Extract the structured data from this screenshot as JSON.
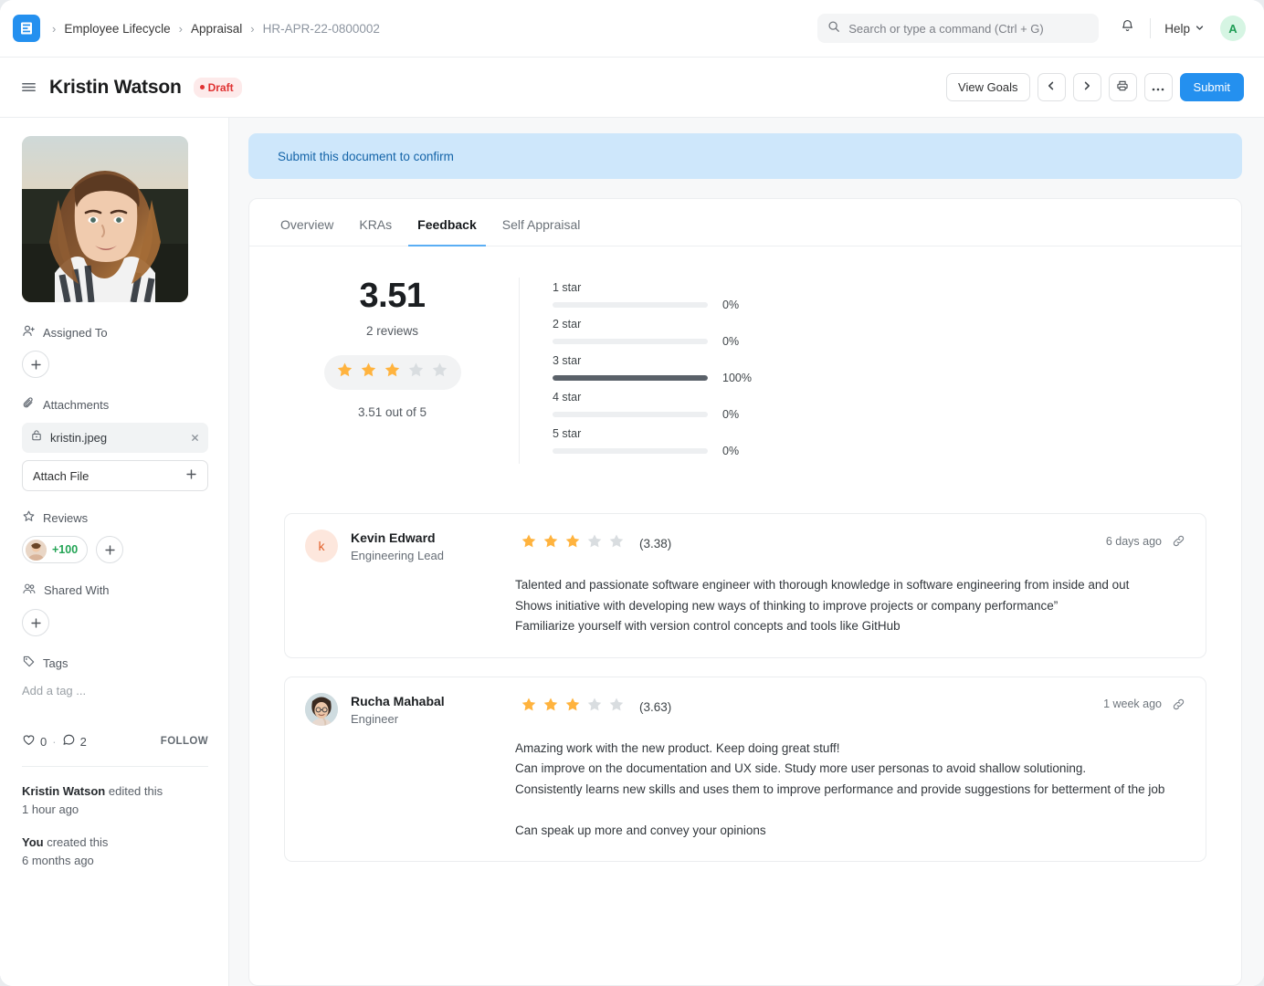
{
  "navbar": {
    "logo_icon": "frappe-logo-icon",
    "breadcrumb": [
      {
        "label": "Employee Lifecycle",
        "current": false
      },
      {
        "label": "Appraisal",
        "current": false
      },
      {
        "label": "HR-APR-22-0800002",
        "current": true
      }
    ],
    "search_placeholder": "Search or type a command (Ctrl + G)",
    "search_value": "",
    "search_icon": "search-icon",
    "notification_icon": "bell-icon",
    "help_label": "Help",
    "help_chevron_icon": "chevron-down-icon",
    "avatar_initial": "A"
  },
  "pagehead": {
    "menu_icon": "hamburger-menu-icon",
    "title": "Kristin Watson",
    "status": "Draft",
    "actions": {
      "view_goals": "View Goals",
      "prev_icon": "chevron-left-icon",
      "next_icon": "chevron-right-icon",
      "print_icon": "printer-icon",
      "more_icon": "ellipsis-icon",
      "submit": "Submit"
    }
  },
  "sidebar": {
    "profile_photo_alt": "Kristin Watson portrait",
    "assigned_to": {
      "label": "Assigned To",
      "icon": "user-plus-icon",
      "add": "+"
    },
    "attachments": {
      "label": "Attachments",
      "icon": "paperclip-icon",
      "files": [
        {
          "name": "kristin.jpeg",
          "icon": "file-lock-icon",
          "remove_icon": "close-icon"
        }
      ],
      "attach_button": "Attach File",
      "attach_button_icon": "plus-icon"
    },
    "reviews": {
      "label": "Reviews",
      "icon": "star-outline-icon",
      "count": "+100",
      "add": "+"
    },
    "shared_with": {
      "label": "Shared With",
      "icon": "users-icon",
      "add": "+"
    },
    "tags": {
      "label": "Tags",
      "icon": "tag-icon",
      "placeholder": "Add a tag ..."
    },
    "footer": {
      "like_icon": "heart-icon",
      "like_count": "0",
      "separator": "·",
      "comment_icon": "comment-icon",
      "comment_count": "2",
      "follow_label": "FOLLOW",
      "activity": [
        {
          "actor": "Kristin Watson",
          "action": " edited this",
          "time": "1 hour ago"
        },
        {
          "actor": "You",
          "action": " created this",
          "time": "6 months ago"
        }
      ]
    }
  },
  "main": {
    "alert": "Submit this document to confirm",
    "tabs": [
      {
        "label": "Overview",
        "active": false
      },
      {
        "label": "KRAs",
        "active": false
      },
      {
        "label": "Feedback",
        "active": true
      },
      {
        "label": "Self Appraisal",
        "active": false
      }
    ],
    "rating_summary": {
      "score": "3.51",
      "reviews_text": "2 reviews",
      "stars_filled": 3,
      "stars_total": 5,
      "out_of_text": "3.51 out of 5"
    },
    "reviews": [
      {
        "reviewer": "Kevin Edward",
        "role": "Engineering Lead",
        "avatar_kind": "initial",
        "avatar_initial": "k",
        "avatar_bg": "#fde7dd",
        "avatar_color": "#e2622c",
        "stars_filled": 3,
        "stars_total": 5,
        "score": "(3.38)",
        "time": "6 days ago",
        "link_icon": "link-icon",
        "text": "Talented and passionate software engineer with thorough knowledge in software engineering from inside and out\nShows initiative with developing new ways of thinking to improve projects or company performance”\nFamiliarize yourself with version control concepts and tools like GitHub"
      },
      {
        "reviewer": "Rucha Mahabal",
        "role": "Engineer",
        "avatar_kind": "photo",
        "avatar_initial": "",
        "avatar_bg": "#cfdce0",
        "avatar_color": "#3b4045",
        "stars_filled": 3,
        "stars_total": 5,
        "score": "(3.63)",
        "time": "1 week ago",
        "link_icon": "link-icon",
        "text": "Amazing work with the new product. Keep doing great stuff!\nCan improve on the documentation and UX side. Study more user personas to avoid shallow solutioning.\nConsistently learns new skills and uses them to improve performance and provide suggestions for betterment of the job\n\nCan speak up more and convey your opinions"
      }
    ]
  },
  "chart_data": {
    "type": "bar",
    "title": "Rating distribution",
    "categories": [
      "1 star",
      "2 star",
      "3 star",
      "4 star",
      "5 star"
    ],
    "values": [
      0,
      0,
      100,
      0,
      0
    ],
    "value_labels": [
      "0%",
      "0%",
      "100%",
      "0%",
      "0%"
    ],
    "xlabel": "",
    "ylabel": "",
    "ylim": [
      0,
      100
    ],
    "orientation": "horizontal",
    "grid": false,
    "legend": "none",
    "bar_color": "#5a6169",
    "track_color": "#edeff1"
  },
  "colors": {
    "accent": "#2490ef",
    "alert_bg": "#cee7fb",
    "alert_text": "#1464a8",
    "draft_bg": "#fdeaea",
    "draft_text": "#e03232",
    "star_on": "#ffb33e",
    "star_off": "#d9dde0"
  }
}
